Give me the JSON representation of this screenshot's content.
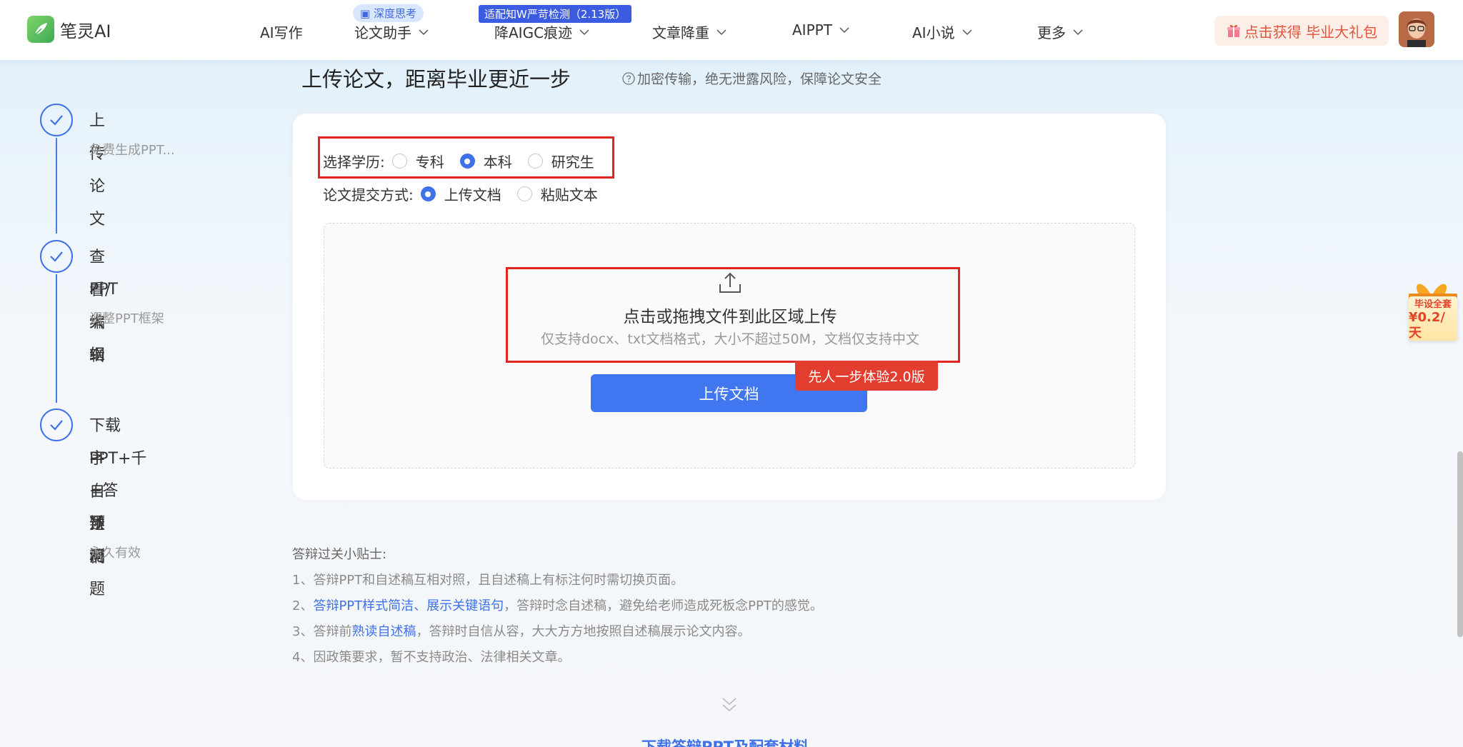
{
  "header": {
    "logo_text": "笔灵AI",
    "nav": [
      {
        "label": "AI写作",
        "has_dropdown": false
      },
      {
        "label": "论文助手",
        "has_dropdown": true
      },
      {
        "label": "降AIGC痕迹",
        "has_dropdown": true
      },
      {
        "label": "文章降重",
        "has_dropdown": true
      },
      {
        "label": "AIPPT",
        "has_dropdown": true
      },
      {
        "label": "AI小说",
        "has_dropdown": true
      },
      {
        "label": "更多",
        "has_dropdown": true
      }
    ],
    "badge_deep_think": "深度思考",
    "badge_adapt": "适配知W严苛检测（2.13版）",
    "promo": "点击获得 毕业大礼包"
  },
  "steps": [
    {
      "title_lines": [
        "上传论文"
      ],
      "subtitle": "免费生成PPT..."
    },
    {
      "title_lines": [
        "查看/编辑",
        "PPT大纲"
      ],
      "subtitle": "调整PPT框架"
    },
    {
      "title_lines": [
        "下载PPT+千",
        "字自述稿",
        "+答辩问题",
        "预测"
      ],
      "subtitle": "永久有效"
    }
  ],
  "main": {
    "title": "上传论文，距离毕业更近一步",
    "security_note": "加密传输，绝无泄露风险，保障论文安全",
    "education": {
      "label": "选择学历:",
      "options": [
        "专科",
        "本科",
        "研究生"
      ],
      "selected": "本科"
    },
    "submit_method": {
      "label": "论文提交方式:",
      "options": [
        "上传文档",
        "粘贴文本"
      ],
      "selected": "上传文档"
    },
    "dropzone": {
      "main_text": "点击或拖拽文件到此区域上传",
      "sub_text": "仅支持docx、txt文档格式，大小不超过50M，文档仅支持中文"
    },
    "upload_button": "上传文档",
    "experience_tag": "先人一步体验2.0版"
  },
  "tips": {
    "title": "答辩过关小贴士:",
    "items": [
      {
        "prefix": "1、答辩PPT和自述稿互相对照，且自述稿上有标注何时需切换页面。",
        "highlight": "",
        "suffix": ""
      },
      {
        "prefix": "2、",
        "highlight": "答辩PPT样式简洁、展示关键语句",
        "suffix": "，答辩时念自述稿，避免给老师造成死板念PPT的感觉。"
      },
      {
        "prefix": "3、答辩前",
        "highlight": "熟读自述稿",
        "suffix": "，答辩时自信从容，大大方方地按照自述稿展示论文内容。"
      },
      {
        "prefix": "4、因政策要求，暂不支持政治、法律相关文章。",
        "highlight": "",
        "suffix": ""
      }
    ]
  },
  "bottom_link": "下载答辩PPT及配套材料",
  "gift": {
    "line1": "毕设全套",
    "line2": "¥0.2/天"
  },
  "colors": {
    "primary": "#3f72e8",
    "red": "#e0261e",
    "promo": "#e2553b"
  }
}
